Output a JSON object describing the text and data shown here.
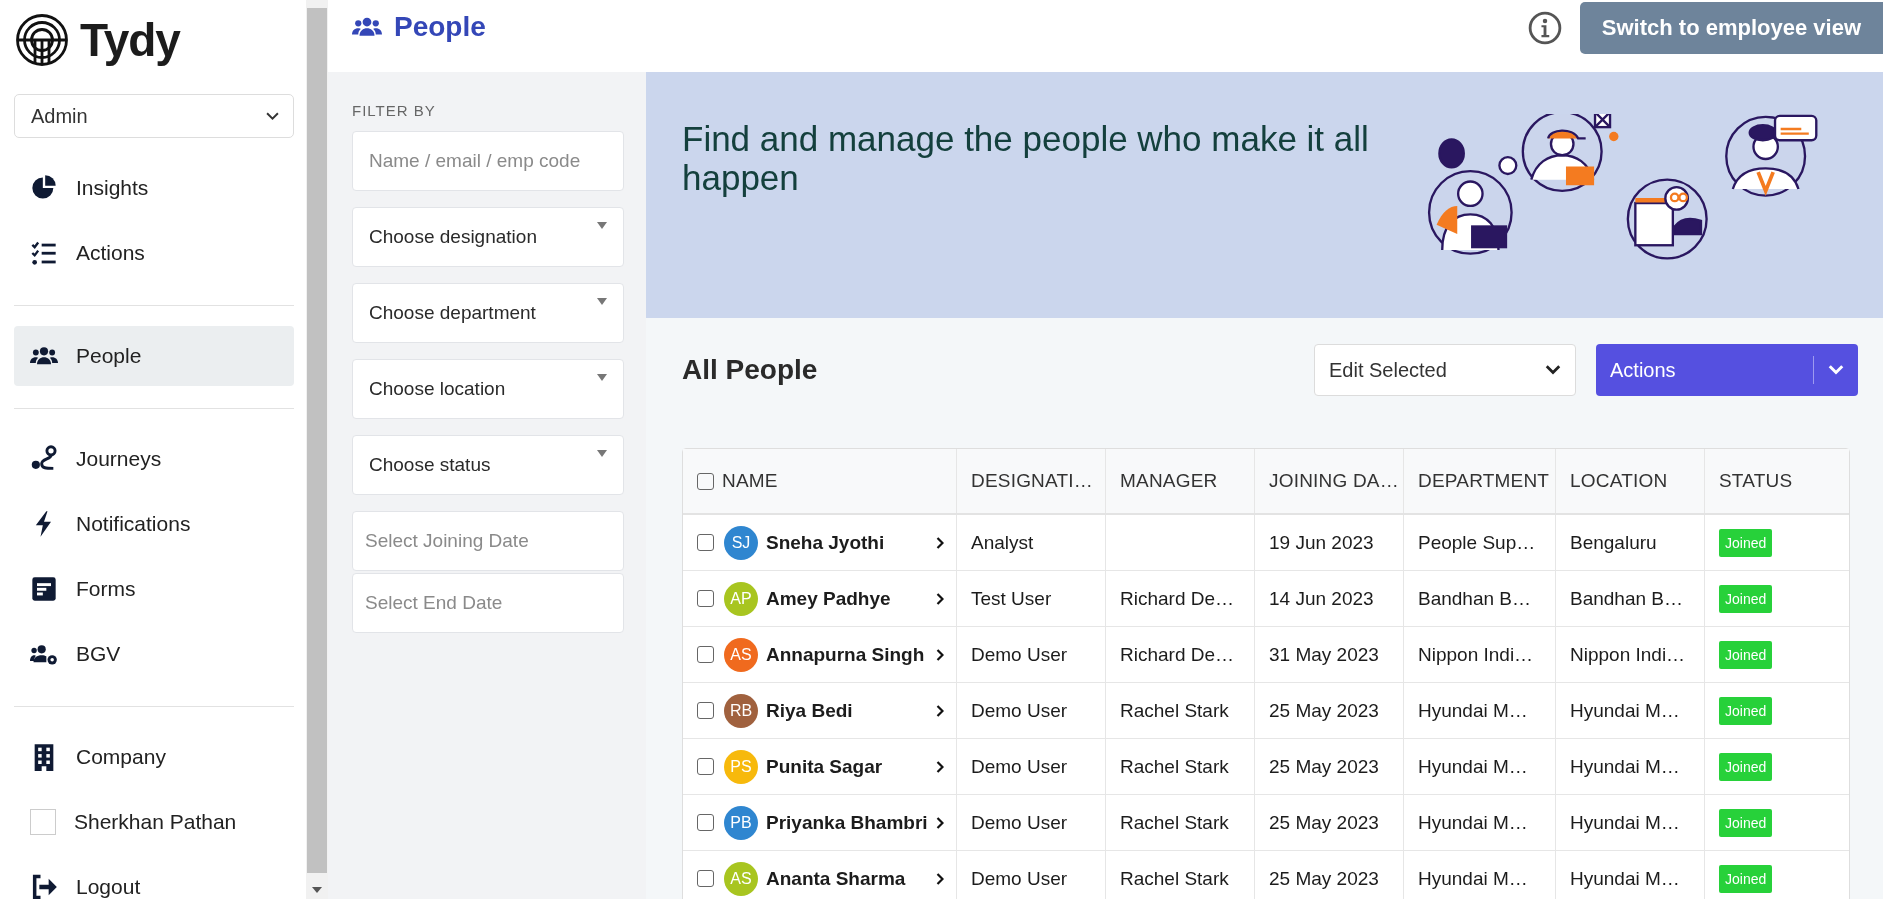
{
  "sidebar": {
    "brand": "Tydy",
    "role_select": {
      "value": "Admin"
    },
    "sections": [
      [
        {
          "label": "Insights",
          "selected": false
        },
        {
          "label": "Actions",
          "selected": false
        }
      ],
      [
        {
          "label": "People",
          "selected": true
        }
      ],
      [
        {
          "label": "Journeys",
          "selected": false
        },
        {
          "label": "Notifications",
          "selected": false
        },
        {
          "label": "Forms",
          "selected": false
        },
        {
          "label": "BGV",
          "selected": false
        }
      ],
      [
        {
          "label": "Company",
          "selected": false
        },
        {
          "label": "Sherkhan Pathan",
          "selected": false
        },
        {
          "label": "Logout",
          "selected": false
        }
      ]
    ]
  },
  "header": {
    "title": "People",
    "button": "Switch to employee view"
  },
  "filters": {
    "heading": "FILTER BY",
    "fields": [
      {
        "kind": "text",
        "placeholder": "Name / email / emp code"
      },
      {
        "kind": "select",
        "placeholder": "Choose designation"
      },
      {
        "kind": "select",
        "placeholder": "Choose department"
      },
      {
        "kind": "select",
        "placeholder": "Choose location"
      },
      {
        "kind": "select",
        "placeholder": "Choose status"
      },
      {
        "kind": "date",
        "placeholder": "Select Joining Date"
      },
      {
        "kind": "date",
        "placeholder": "Select End Date"
      }
    ]
  },
  "banner": {
    "text": "Find and manage the people who make it all happen"
  },
  "list": {
    "heading": "All People",
    "edit_select": "Edit Selected",
    "actions_button": "Actions"
  },
  "table": {
    "select_all_checked": false,
    "columns": [
      "NAME",
      "DESIGNATI…",
      "MANAGER",
      "JOINING DA…",
      "DEPARTMENT",
      "LOCATION",
      "STATUS"
    ],
    "rows": [
      {
        "checked": false,
        "initials": "SJ",
        "color": "#2f86d0",
        "name": "Sneha Jyothi",
        "designation": "Analyst",
        "manager": "",
        "joining_date": "19 Jun 2023",
        "department": "People Sup…",
        "location": "Bengaluru",
        "status": "Joined"
      },
      {
        "checked": false,
        "initials": "AP",
        "color": "#a8c520",
        "name": "Amey Padhye",
        "designation": "Test User",
        "manager": "Richard De…",
        "joining_date": "14 Jun 2023",
        "department": "Bandhan B…",
        "location": "Bandhan B…",
        "status": "Joined"
      },
      {
        "checked": false,
        "initials": "AS",
        "color": "#f06a1e",
        "name": "Annapurna Singh",
        "designation": "Demo User",
        "manager": "Richard De…",
        "joining_date": "31 May 2023",
        "department": "Nippon Indi…",
        "location": "Nippon Indi…",
        "status": "Joined"
      },
      {
        "checked": false,
        "initials": "RB",
        "color": "#a0613e",
        "name": "Riya Bedi",
        "designation": "Demo User",
        "manager": "Rachel Stark",
        "joining_date": "25 May 2023",
        "department": "Hyundai M…",
        "location": "Hyundai M…",
        "status": "Joined"
      },
      {
        "checked": false,
        "initials": "PS",
        "color": "#f7b90c",
        "name": "Punita Sagar",
        "designation": "Demo User",
        "manager": "Rachel Stark",
        "joining_date": "25 May 2023",
        "department": "Hyundai M…",
        "location": "Hyundai M…",
        "status": "Joined"
      },
      {
        "checked": false,
        "initials": "PB",
        "color": "#2f86d0",
        "name": "Priyanka Bhambri",
        "designation": "Demo User",
        "manager": "Rachel Stark",
        "joining_date": "25 May 2023",
        "department": "Hyundai M…",
        "location": "Hyundai M…",
        "status": "Joined"
      },
      {
        "checked": false,
        "initials": "AS",
        "color": "#a8c520",
        "name": "Ananta Sharma",
        "designation": "Demo User",
        "manager": "Rachel Stark",
        "joining_date": "25 May 2023",
        "department": "Hyundai M…",
        "location": "Hyundai M…",
        "status": "Joined"
      }
    ]
  }
}
